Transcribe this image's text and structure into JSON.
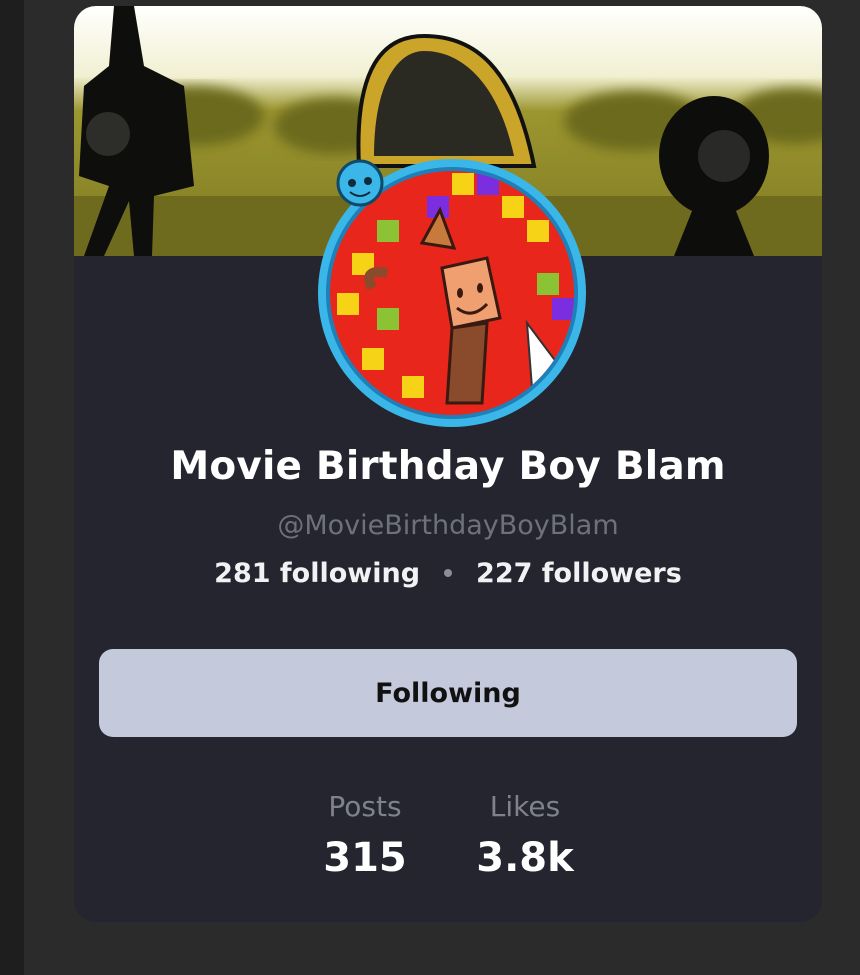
{
  "profile": {
    "display_name": "Movie Birthday Boy Blam",
    "handle": "@MovieBirthdayBoyBlam",
    "following": "281 following",
    "followers": "227 followers"
  },
  "actions": {
    "follow_button_label": "Following"
  },
  "metrics": {
    "posts_label": "Posts",
    "posts_value": "315",
    "likes_label": "Likes",
    "likes_value": "3.8k"
  },
  "colors": {
    "card_background": "#24252f",
    "button_background": "#c4cadb",
    "avatar_ring": "#3ab6e8",
    "banner_tint": "#8b8720"
  }
}
